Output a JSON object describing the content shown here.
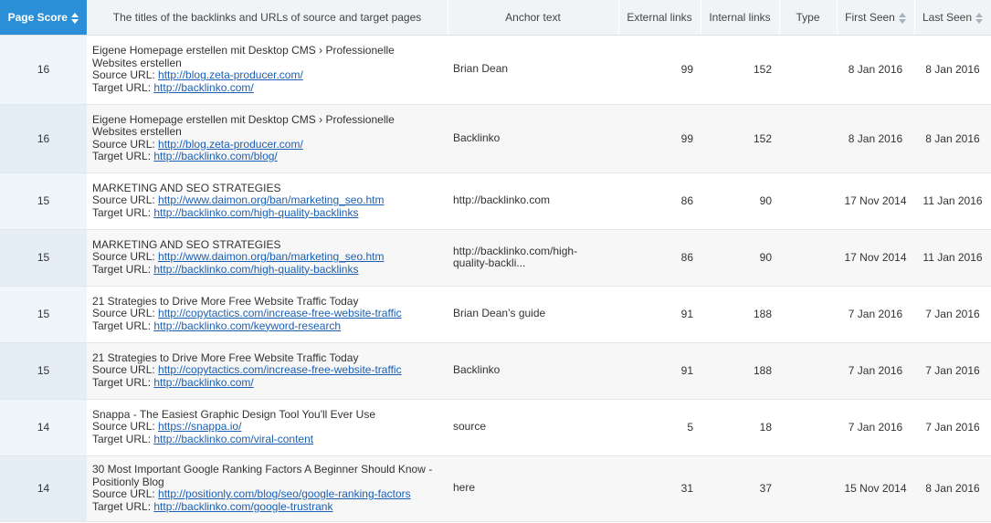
{
  "headers": {
    "page_score": "Page Score",
    "titles": "The titles of the backlinks and URLs of source and target pages",
    "anchor": "Anchor text",
    "external": "External links",
    "internal": "Internal links",
    "type": "Type",
    "first_seen": "First Seen",
    "last_seen": "Last Seen"
  },
  "labels": {
    "source": "Source URL: ",
    "target": "Target URL: "
  },
  "rows": [
    {
      "score": "16",
      "title1": "Eigene Homepage erstellen mit Desktop CMS › Professionelle",
      "title2": "Websites erstellen",
      "source": "http://blog.zeta-producer.com/",
      "target": "http://backlinko.com/",
      "anchor1": "Brian Dean",
      "anchor2": "",
      "external": "99",
      "internal": "152",
      "type": "",
      "first_seen": "8 Jan 2016",
      "last_seen": "8 Jan 2016"
    },
    {
      "score": "16",
      "title1": "Eigene Homepage erstellen mit Desktop CMS › Professionelle",
      "title2": "Websites erstellen",
      "source": "http://blog.zeta-producer.com/",
      "target": "http://backlinko.com/blog/",
      "anchor1": "Backlinko",
      "anchor2": "",
      "external": "99",
      "internal": "152",
      "type": "",
      "first_seen": "8 Jan 2016",
      "last_seen": "8 Jan 2016"
    },
    {
      "score": "15",
      "title1": "MARKETING AND SEO STRATEGIES",
      "title2": "",
      "source": "http://www.daimon.org/ban/marketing_seo.htm",
      "target": "http://backlinko.com/high-quality-backlinks",
      "anchor1": "http://backlinko.com",
      "anchor2": "",
      "external": "86",
      "internal": "90",
      "type": "",
      "first_seen": "17 Nov 2014",
      "last_seen": "11 Jan 2016"
    },
    {
      "score": "15",
      "title1": "MARKETING AND SEO STRATEGIES",
      "title2": "",
      "source": "http://www.daimon.org/ban/marketing_seo.htm",
      "target": "http://backlinko.com/high-quality-backlinks",
      "anchor1": "http://backlinko.com/high-",
      "anchor2": "quality-backli...",
      "external": "86",
      "internal": "90",
      "type": "",
      "first_seen": "17 Nov 2014",
      "last_seen": "11 Jan 2016"
    },
    {
      "score": "15",
      "title1": "21 Strategies to Drive More Free Website Traffic Today",
      "title2": "",
      "source": "http://copytactics.com/increase-free-website-traffic",
      "target": "http://backlinko.com/keyword-research",
      "anchor1": "Brian Dean’s guide",
      "anchor2": "",
      "external": "91",
      "internal": "188",
      "type": "",
      "first_seen": "7 Jan 2016",
      "last_seen": "7 Jan 2016"
    },
    {
      "score": "15",
      "title1": "21 Strategies to Drive More Free Website Traffic Today",
      "title2": "",
      "source": "http://copytactics.com/increase-free-website-traffic",
      "target": "http://backlinko.com/",
      "anchor1": "Backlinko",
      "anchor2": "",
      "external": "91",
      "internal": "188",
      "type": "",
      "first_seen": "7 Jan 2016",
      "last_seen": "7 Jan 2016"
    },
    {
      "score": "14",
      "title1": "Snappa - The Easiest Graphic Design Tool You'll Ever Use",
      "title2": "",
      "source": "https://snappa.io/",
      "target": "http://backlinko.com/viral-content",
      "anchor1": "source",
      "anchor2": "",
      "external": "5",
      "internal": "18",
      "type": "",
      "first_seen": "7 Jan 2016",
      "last_seen": "7 Jan 2016"
    },
    {
      "score": "14",
      "title1": "30 Most Important Google Ranking Factors A Beginner Should Know -",
      "title2": "Positionly Blog",
      "source": "http://positionly.com/blog/seo/google-ranking-factors",
      "target": "http://backlinko.com/google-trustrank",
      "anchor1": "here",
      "anchor2": "",
      "external": "31",
      "internal": "37",
      "type": "",
      "first_seen": "15 Nov 2014",
      "last_seen": "8 Jan 2016"
    }
  ]
}
